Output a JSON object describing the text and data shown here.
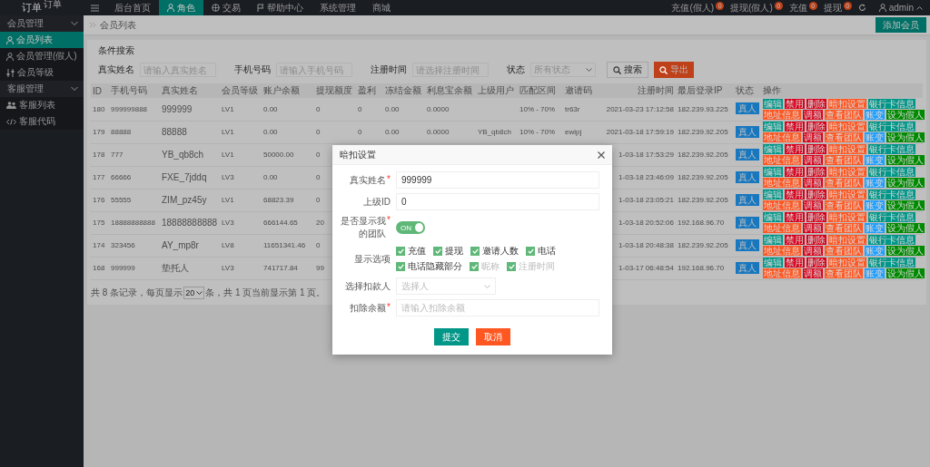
{
  "brand": {
    "title": "订单",
    "sup": "订单"
  },
  "topbar": {
    "nav": [
      {
        "label": "后台首页",
        "selected": false
      },
      {
        "label": "角色",
        "selected": true
      },
      {
        "label": "交易",
        "selected": false
      },
      {
        "label": "帮助中心",
        "selected": false
      },
      {
        "label": "系统管理",
        "selected": false
      },
      {
        "label": "商城",
        "selected": false
      }
    ],
    "links": [
      {
        "label": "充值(假人)",
        "badge": "0"
      },
      {
        "label": "提现(假人)",
        "badge": "0"
      },
      {
        "label": "充值",
        "badge": "0"
      },
      {
        "label": "提现",
        "badge": "0"
      }
    ],
    "user": "admin"
  },
  "sidebar": {
    "groups": [
      {
        "label": "会员管理",
        "expanded": true,
        "items": [
          {
            "label": "会员列表",
            "selected": true
          },
          {
            "label": "会员管理(假人)",
            "selected": false
          },
          {
            "label": "会员等级",
            "selected": false
          }
        ]
      },
      {
        "label": "客服管理",
        "expanded": true,
        "items": [
          {
            "label": "客服列表",
            "selected": false
          },
          {
            "label": "客服代码",
            "selected": false
          }
        ]
      }
    ]
  },
  "page": {
    "breadcrumb": "会员列表",
    "add_button": "添加会员",
    "search": {
      "title": "条件搜索",
      "fields": [
        {
          "kind": "input",
          "label": "真实姓名",
          "placeholder": "请输入真实姓名"
        },
        {
          "kind": "input",
          "label": "手机号码",
          "placeholder": "请输入手机号码"
        },
        {
          "kind": "input",
          "label": "注册时间",
          "placeholder": "请选择注册时间"
        },
        {
          "kind": "select",
          "label": "状态",
          "placeholder": "所有状态"
        }
      ],
      "search_button": "搜索",
      "export_button": "导出"
    },
    "table": {
      "columns": [
        "ID",
        "手机号码",
        "真实姓名",
        "会员等级",
        "账户余额",
        "提现额度",
        "盈利",
        "冻结金额",
        "利息宝余额",
        "上级用户",
        "匹配区间",
        "邀请码",
        "注册时间",
        "最后登录IP",
        "状态",
        "操作"
      ],
      "rows": [
        {
          "id": "180",
          "phone": "999999888",
          "name": "999999",
          "level": "LV1",
          "balance": "0.00",
          "withdraw": "0",
          "profit": "0",
          "frozen": "0.00",
          "interest": "0.0000",
          "match": "10% - 70%",
          "invite": "tr63r",
          "reg_time": "2021-03-23 17:12:58",
          "ip": "182.239.93.225",
          "status": "真人",
          "actions": [
            [
              {
                "label": "编辑",
                "color": "#009688"
              },
              {
                "label": "禁用",
                "color": "#d9001b"
              },
              {
                "label": "删除",
                "color": "#d9001b"
              },
              {
                "label": "暗扣设置",
                "color": "#ff5722"
              },
              {
                "label": "银行卡信息",
                "color": "#009688"
              }
            ],
            [
              {
                "label": "地址信息",
                "color": "#ff5722"
              },
              {
                "label": "调额",
                "color": "#d9001b"
              },
              {
                "label": "查看团队",
                "color": "#ff5722"
              },
              {
                "label": "账变",
                "color": "#1e9fff"
              },
              {
                "label": "设为假人",
                "color": "#008a00"
              }
            ]
          ]
        },
        {
          "id": "179",
          "phone": "88888",
          "name": "88888",
          "level": "LV1",
          "balance": "0.00",
          "withdraw": "0",
          "profit": "0",
          "frozen": "0.00",
          "interest": "0.0000",
          "upline": "YB_qb8ch",
          "match": "10% - 70%",
          "invite": "ewipj",
          "reg_time": "2021-03-18 17:59:19",
          "ip": "182.239.92.205",
          "status": "真人",
          "actions": [
            [
              {
                "label": "编辑",
                "color": "#009688"
              },
              {
                "label": "禁用",
                "color": "#d9001b"
              },
              {
                "label": "删除",
                "color": "#d9001b"
              },
              {
                "label": "暗扣设置",
                "color": "#ff5722"
              },
              {
                "label": "银行卡信息",
                "color": "#009688"
              }
            ],
            [
              {
                "label": "地址信息",
                "color": "#ff5722"
              },
              {
                "label": "调额",
                "color": "#d9001b"
              },
              {
                "label": "查看团队",
                "color": "#ff5722"
              },
              {
                "label": "账变",
                "color": "#1e9fff"
              },
              {
                "label": "设为假人",
                "color": "#008a00"
              }
            ]
          ]
        },
        {
          "id": "178",
          "phone": "777",
          "name": "YB_qb8ch",
          "level": "LV1",
          "balance": "50000.00",
          "withdraw": "0",
          "reg_time": "1-03-18 17:53:29",
          "ip": "182.239.92.205",
          "status": "真人",
          "actions": [
            [
              {
                "label": "编辑",
                "color": "#009688"
              },
              {
                "label": "禁用",
                "color": "#d9001b"
              },
              {
                "label": "删除",
                "color": "#d9001b"
              },
              {
                "label": "暗扣设置",
                "color": "#ff5722"
              },
              {
                "label": "银行卡信息",
                "color": "#009688"
              }
            ],
            [
              {
                "label": "地址信息",
                "color": "#ff5722"
              },
              {
                "label": "调额",
                "color": "#d9001b"
              },
              {
                "label": "查看团队",
                "color": "#ff5722"
              },
              {
                "label": "账变",
                "color": "#1e9fff"
              },
              {
                "label": "设为假人",
                "color": "#008a00"
              }
            ]
          ]
        },
        {
          "id": "177",
          "phone": "66666",
          "name": "FXE_7jddq",
          "level": "LV3",
          "balance": "0.00",
          "withdraw": "0",
          "reg_time": "1-03-18 23:46:09",
          "ip": "182.239.92.205",
          "status": "真人",
          "actions": [
            [
              {
                "label": "编辑",
                "color": "#009688"
              },
              {
                "label": "禁用",
                "color": "#d9001b"
              },
              {
                "label": "删除",
                "color": "#d9001b"
              },
              {
                "label": "暗扣设置",
                "color": "#ff5722"
              },
              {
                "label": "银行卡信息",
                "color": "#009688"
              }
            ],
            [
              {
                "label": "地址信息",
                "color": "#ff5722"
              },
              {
                "label": "调额",
                "color": "#d9001b"
              },
              {
                "label": "查看团队",
                "color": "#ff5722"
              },
              {
                "label": "账变",
                "color": "#1e9fff"
              },
              {
                "label": "设为假人",
                "color": "#008a00"
              }
            ]
          ]
        },
        {
          "id": "176",
          "phone": "55555",
          "name": "ZIM_pz45y",
          "level": "LV1",
          "balance": "68823.39",
          "withdraw": "0",
          "reg_time": "1-03-18 23:05:21",
          "ip": "182.239.92.205",
          "status": "真人",
          "actions": [
            [
              {
                "label": "编辑",
                "color": "#009688"
              },
              {
                "label": "禁用",
                "color": "#d9001b"
              },
              {
                "label": "删除",
                "color": "#d9001b"
              },
              {
                "label": "暗扣设置",
                "color": "#ff5722"
              },
              {
                "label": "银行卡信息",
                "color": "#009688"
              }
            ],
            [
              {
                "label": "地址信息",
                "color": "#ff5722"
              },
              {
                "label": "调额",
                "color": "#d9001b"
              },
              {
                "label": "查看团队",
                "color": "#ff5722"
              },
              {
                "label": "账变",
                "color": "#1e9fff"
              },
              {
                "label": "设为假人",
                "color": "#008a00"
              }
            ]
          ]
        },
        {
          "id": "175",
          "phone": "18888888888",
          "name": "18888888888",
          "level": "LV3",
          "balance": "666144.65",
          "withdraw": "20",
          "reg_time": "1-03-18 20:52:06",
          "ip": "192.168.96.70",
          "status": "真人",
          "actions": [
            [
              {
                "label": "编辑",
                "color": "#009688"
              },
              {
                "label": "禁用",
                "color": "#d9001b"
              },
              {
                "label": "删除",
                "color": "#d9001b"
              },
              {
                "label": "暗扣设置",
                "color": "#ff5722"
              },
              {
                "label": "银行卡信息",
                "color": "#009688"
              }
            ],
            [
              {
                "label": "地址信息",
                "color": "#ff5722"
              },
              {
                "label": "调额",
                "color": "#d9001b"
              },
              {
                "label": "查看团队",
                "color": "#ff5722"
              },
              {
                "label": "账变",
                "color": "#1e9fff"
              },
              {
                "label": "设为假人",
                "color": "#008a00"
              }
            ]
          ]
        },
        {
          "id": "174",
          "phone": "323456",
          "name": "AY_mp8r",
          "level": "LV8",
          "balance": "11651341.46",
          "withdraw": "0",
          "reg_time": "1-03-18 20:48:38",
          "ip": "182.239.92.205",
          "status": "真人",
          "actions": [
            [
              {
                "label": "编辑",
                "color": "#009688"
              },
              {
                "label": "禁用",
                "color": "#d9001b"
              },
              {
                "label": "删除",
                "color": "#d9001b"
              },
              {
                "label": "暗扣设置",
                "color": "#ff5722"
              },
              {
                "label": "银行卡信息",
                "color": "#009688"
              }
            ],
            [
              {
                "label": "地址信息",
                "color": "#ff5722"
              },
              {
                "label": "调额",
                "color": "#d9001b"
              },
              {
                "label": "查看团队",
                "color": "#ff5722"
              },
              {
                "label": "账变",
                "color": "#1e9fff"
              },
              {
                "label": "设为假人",
                "color": "#008a00"
              }
            ]
          ]
        },
        {
          "id": "168",
          "phone": "999999",
          "name": "垫托人",
          "level": "LV3",
          "balance": "741717.84",
          "withdraw": "99",
          "reg_time": "1-03-17 06:48:54",
          "ip": "192.168.96.70",
          "status": "真人",
          "actions": [
            [
              {
                "label": "编辑",
                "color": "#009688"
              },
              {
                "label": "禁用",
                "color": "#d9001b"
              },
              {
                "label": "删除",
                "color": "#d9001b"
              },
              {
                "label": "暗扣设置",
                "color": "#ff5722"
              },
              {
                "label": "银行卡信息",
                "color": "#009688"
              }
            ],
            [
              {
                "label": "地址信息",
                "color": "#ff5722"
              },
              {
                "label": "调额",
                "color": "#d9001b"
              },
              {
                "label": "查看团队",
                "color": "#ff5722"
              },
              {
                "label": "账变",
                "color": "#1e9fff"
              },
              {
                "label": "设为假人",
                "color": "#008a00"
              }
            ]
          ]
        }
      ]
    },
    "pager": {
      "prefix": "共 8 条记录，每页显示",
      "page_size": "20",
      "suffix": "条，共 1 页当前显示第 1 页。"
    }
  },
  "modal": {
    "title": "暗扣设置",
    "fields": [
      {
        "kind": "text",
        "label": "真实姓名",
        "required_mark": "*",
        "value": "999999"
      },
      {
        "kind": "text",
        "label": "上级ID",
        "value": "0"
      },
      {
        "kind": "toggle",
        "label": "是否显示我的团队",
        "required_mark": "*",
        "on": true,
        "text": "ON"
      },
      {
        "kind": "checks",
        "label": "显示选项",
        "options": [
          {
            "label": "充值",
            "checked": true,
            "disabled": false
          },
          {
            "label": "提现",
            "checked": true,
            "disabled": false
          },
          {
            "label": "邀请人数",
            "checked": true,
            "disabled": false
          },
          {
            "label": "电话",
            "checked": true,
            "disabled": false
          },
          {
            "label": "电话隐藏部分",
            "checked": true,
            "disabled": false
          },
          {
            "label": "昵称",
            "checked": true,
            "disabled": true
          },
          {
            "label": "注册时间",
            "checked": true,
            "disabled": true
          }
        ]
      },
      {
        "kind": "select",
        "label": "选择扣款人",
        "placeholder": "选择人"
      },
      {
        "kind": "text",
        "label": "扣除余额",
        "required_mark": "*",
        "placeholder": "请输入扣除余额"
      }
    ],
    "buttons": [
      {
        "label": "提交",
        "kind": "primary"
      },
      {
        "label": "取消",
        "kind": "danger"
      }
    ]
  }
}
